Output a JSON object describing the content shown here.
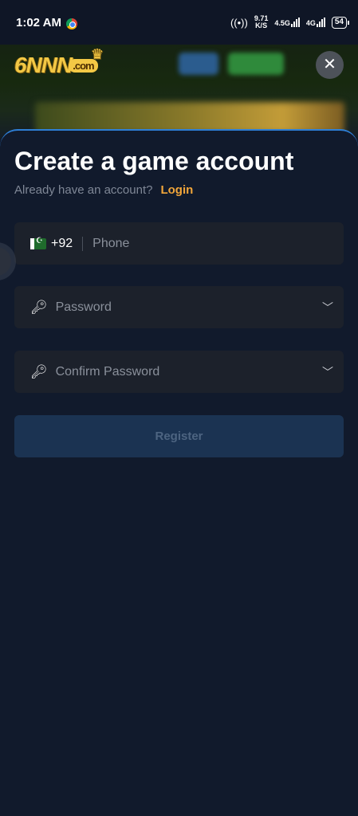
{
  "status_bar": {
    "time": "1:02 AM",
    "speed_value": "9.71",
    "speed_unit": "K/S",
    "net1": "4.5G",
    "net2": "4G",
    "battery": "54"
  },
  "header": {
    "logo_main": "6NNN",
    "logo_suffix": ".com",
    "close_label": "✕"
  },
  "form": {
    "title": "Create a game account",
    "subtitle": "Already have an account?",
    "login_link": "Login",
    "phone": {
      "country_code": "+92",
      "placeholder": "Phone"
    },
    "password": {
      "placeholder": "Password"
    },
    "confirm_password": {
      "placeholder": "Confirm Password"
    },
    "register_label": "Register"
  },
  "colors": {
    "background": "#111a2c",
    "accent_link": "#f2a63a",
    "field_bg": "#1c212b",
    "register_bg": "#1b3352"
  }
}
